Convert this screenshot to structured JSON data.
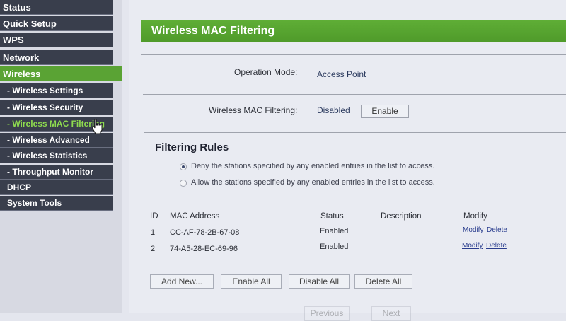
{
  "sidebar": {
    "items": [
      {
        "label": "Status"
      },
      {
        "label": "Quick Setup"
      },
      {
        "label": "WPS"
      },
      {
        "label": "Network"
      },
      {
        "label": "Wireless"
      },
      {
        "label": "- Wireless Settings"
      },
      {
        "label": "- Wireless Security"
      },
      {
        "label": "- Wireless MAC Filtering"
      },
      {
        "label": "- Wireless Advanced"
      },
      {
        "label": "- Wireless Statistics"
      },
      {
        "label": "- Throughput Monitor"
      },
      {
        "label": "DHCP"
      },
      {
        "label": "System Tools"
      }
    ]
  },
  "header": {
    "title": "Wireless MAC Filtering"
  },
  "operation_mode": {
    "label": "Operation Mode:",
    "value": "Access Point"
  },
  "mac_filtering": {
    "label": "Wireless MAC Filtering:",
    "status": "Disabled",
    "button": "Enable"
  },
  "rules": {
    "title": "Filtering Rules",
    "deny_label": "Deny the stations specified by any enabled entries in the list to access.",
    "allow_label": "Allow the stations specified by any enabled entries in the list to access.",
    "selected": "deny"
  },
  "table": {
    "headers": {
      "id": "ID",
      "mac": "MAC Address",
      "status": "Status",
      "description": "Description",
      "modify": "Modify"
    },
    "rows": [
      {
        "id": "1",
        "mac": "CC-AF-78-2B-67-08",
        "status": "Enabled",
        "description": "",
        "modify": "Modify",
        "delete": "Delete"
      },
      {
        "id": "2",
        "mac": "74-A5-28-EC-69-96",
        "status": "Enabled",
        "description": "",
        "modify": "Modify",
        "delete": "Delete"
      }
    ]
  },
  "actions": {
    "add_new": "Add New...",
    "enable_all": "Enable All",
    "disable_all": "Disable All",
    "delete_all": "Delete All"
  },
  "pager": {
    "previous": "Previous",
    "next": "Next"
  },
  "colors": {
    "accent": "#5aa334",
    "nav_bg": "#393e4c",
    "current_text": "#8edb4f"
  }
}
